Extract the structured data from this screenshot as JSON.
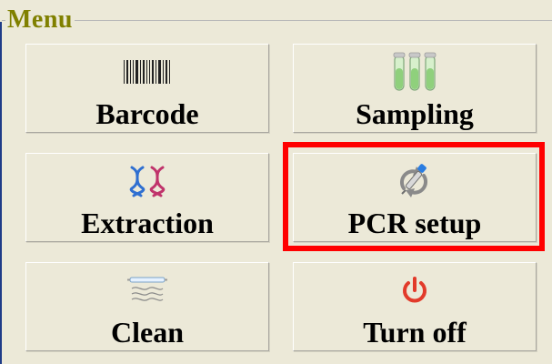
{
  "menu": {
    "title": "Menu",
    "items": [
      {
        "label": "Barcode",
        "icon": "barcode-icon"
      },
      {
        "label": "Sampling",
        "icon": "test-tubes-icon"
      },
      {
        "label": "Extraction",
        "icon": "dna-icon"
      },
      {
        "label": "PCR setup",
        "icon": "pipette-refresh-icon"
      },
      {
        "label": "Clean",
        "icon": "uv-lamp-icon"
      },
      {
        "label": "Turn off",
        "icon": "power-icon"
      }
    ]
  },
  "highlight": {
    "target": "PCR setup",
    "color": "#ff0000"
  },
  "colors": {
    "title": "#808000",
    "background": "#ece9d8",
    "power": "#e23a2a",
    "dna_blue": "#2f6fd1",
    "dna_magenta": "#c0336b",
    "tubes": "#9bd38a"
  }
}
